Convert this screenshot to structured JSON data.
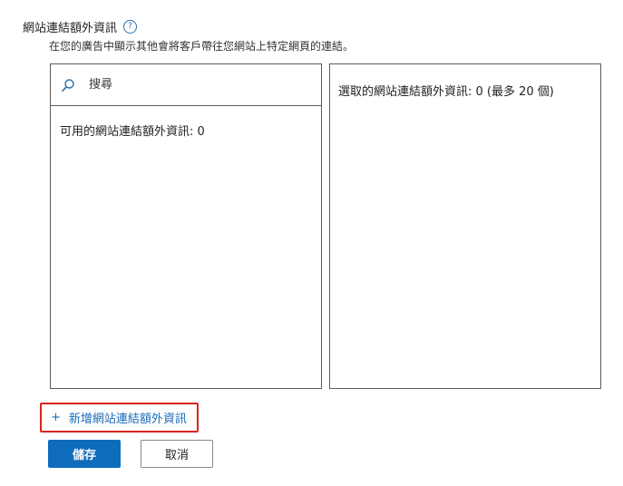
{
  "section": {
    "title": "網站連結額外資訊",
    "help_icon": "question-mark-circle",
    "description": "在您的廣告中顯示其他會將客戶帶往您網站上特定網頁的連結。"
  },
  "available_panel": {
    "search_placeholder": "搜尋",
    "search_icon": "magnifier",
    "count_label": "可用的網站連結額外資訊: 0"
  },
  "selected_panel": {
    "count_label": "選取的網站連結額外資訊: 0 (最多 20 個)"
  },
  "add_link": {
    "plus": "+",
    "label": "新增網站連結額外資訊"
  },
  "actions": {
    "save_label": "儲存",
    "cancel_label": "取消"
  },
  "colors": {
    "accent": "#0f6cbd",
    "link": "#1a6bb8",
    "highlight_border": "#e0231e"
  }
}
